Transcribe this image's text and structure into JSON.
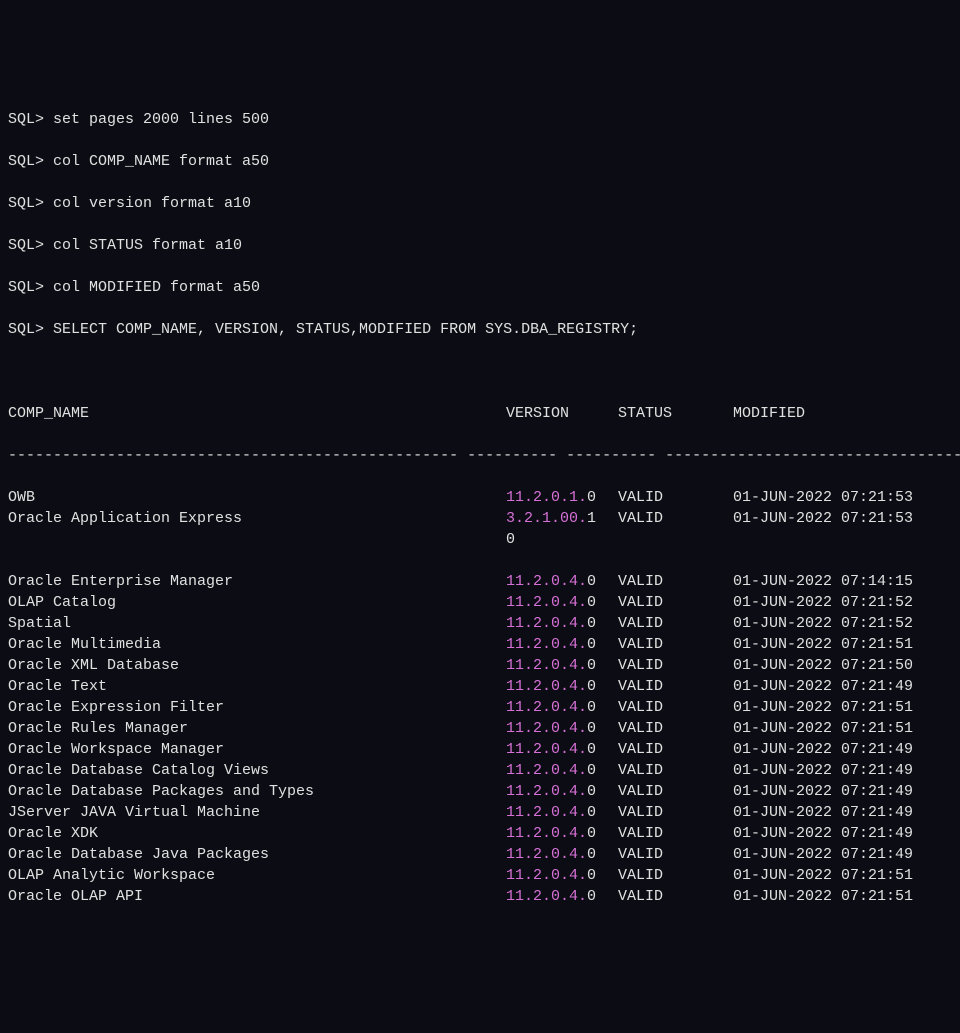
{
  "commands": [
    "SQL> set pages 2000 lines 500",
    "SQL> col COMP_NAME format a50",
    "SQL> col version format a10",
    "SQL> col STATUS format a10",
    "SQL> col MODIFIED format a50",
    "SQL> SELECT COMP_NAME, VERSION, STATUS,MODIFIED FROM SYS.DBA_REGISTRY;"
  ],
  "headers": {
    "comp_name": "COMP_NAME",
    "version": "VERSION",
    "status": "STATUS",
    "modified": "MODIFIED"
  },
  "rows": [
    {
      "comp": "OWB",
      "ver_hl": "11.2.0.1.",
      "ver_sfx": "0",
      "status": "VALID",
      "modified": "01-JUN-2022 07:21:53",
      "wrap": ""
    },
    {
      "comp": "Oracle Application Express",
      "ver_hl": "3.2.1.00.",
      "ver_sfx": "1",
      "status": "VALID",
      "modified": "01-JUN-2022 07:21:53",
      "wrap": "0"
    },
    {
      "comp": "",
      "ver_hl": "",
      "ver_sfx": "",
      "status": "",
      "modified": "",
      "wrap": ""
    },
    {
      "comp": "Oracle Enterprise Manager",
      "ver_hl": "11.2.0.4.",
      "ver_sfx": "0",
      "status": "VALID",
      "modified": "01-JUN-2022 07:14:15",
      "wrap": ""
    },
    {
      "comp": "OLAP Catalog",
      "ver_hl": "11.2.0.4.",
      "ver_sfx": "0",
      "status": "VALID",
      "modified": "01-JUN-2022 07:21:52",
      "wrap": ""
    },
    {
      "comp": "Spatial",
      "ver_hl": "11.2.0.4.",
      "ver_sfx": "0",
      "status": "VALID",
      "modified": "01-JUN-2022 07:21:52",
      "wrap": ""
    },
    {
      "comp": "Oracle Multimedia",
      "ver_hl": "11.2.0.4.",
      "ver_sfx": "0",
      "status": "VALID",
      "modified": "01-JUN-2022 07:21:51",
      "wrap": ""
    },
    {
      "comp": "Oracle XML Database",
      "ver_hl": "11.2.0.4.",
      "ver_sfx": "0",
      "status": "VALID",
      "modified": "01-JUN-2022 07:21:50",
      "wrap": ""
    },
    {
      "comp": "Oracle Text",
      "ver_hl": "11.2.0.4.",
      "ver_sfx": "0",
      "status": "VALID",
      "modified": "01-JUN-2022 07:21:49",
      "wrap": ""
    },
    {
      "comp": "Oracle Expression Filter",
      "ver_hl": "11.2.0.4.",
      "ver_sfx": "0",
      "status": "VALID",
      "modified": "01-JUN-2022 07:21:51",
      "wrap": ""
    },
    {
      "comp": "Oracle Rules Manager",
      "ver_hl": "11.2.0.4.",
      "ver_sfx": "0",
      "status": "VALID",
      "modified": "01-JUN-2022 07:21:51",
      "wrap": ""
    },
    {
      "comp": "Oracle Workspace Manager",
      "ver_hl": "11.2.0.4.",
      "ver_sfx": "0",
      "status": "VALID",
      "modified": "01-JUN-2022 07:21:49",
      "wrap": ""
    },
    {
      "comp": "Oracle Database Catalog Views",
      "ver_hl": "11.2.0.4.",
      "ver_sfx": "0",
      "status": "VALID",
      "modified": "01-JUN-2022 07:21:49",
      "wrap": ""
    },
    {
      "comp": "Oracle Database Packages and Types",
      "ver_hl": "11.2.0.4.",
      "ver_sfx": "0",
      "status": "VALID",
      "modified": "01-JUN-2022 07:21:49",
      "wrap": ""
    },
    {
      "comp": "JServer JAVA Virtual Machine",
      "ver_hl": "11.2.0.4.",
      "ver_sfx": "0",
      "status": "VALID",
      "modified": "01-JUN-2022 07:21:49",
      "wrap": ""
    },
    {
      "comp": "Oracle XDK",
      "ver_hl": "11.2.0.4.",
      "ver_sfx": "0",
      "status": "VALID",
      "modified": "01-JUN-2022 07:21:49",
      "wrap": ""
    },
    {
      "comp": "Oracle Database Java Packages",
      "ver_hl": "11.2.0.4.",
      "ver_sfx": "0",
      "status": "VALID",
      "modified": "01-JUN-2022 07:21:49",
      "wrap": ""
    },
    {
      "comp": "OLAP Analytic Workspace",
      "ver_hl": "11.2.0.4.",
      "ver_sfx": "0",
      "status": "VALID",
      "modified": "01-JUN-2022 07:21:51",
      "wrap": ""
    },
    {
      "comp": "Oracle OLAP API",
      "ver_hl": "11.2.0.4.",
      "ver_sfx": "0",
      "status": "VALID",
      "modified": "01-JUN-2022 07:21:51",
      "wrap": ""
    }
  ],
  "dashline": "-------------------------------------------------- ---------- ---------- --------------------------------------------------"
}
